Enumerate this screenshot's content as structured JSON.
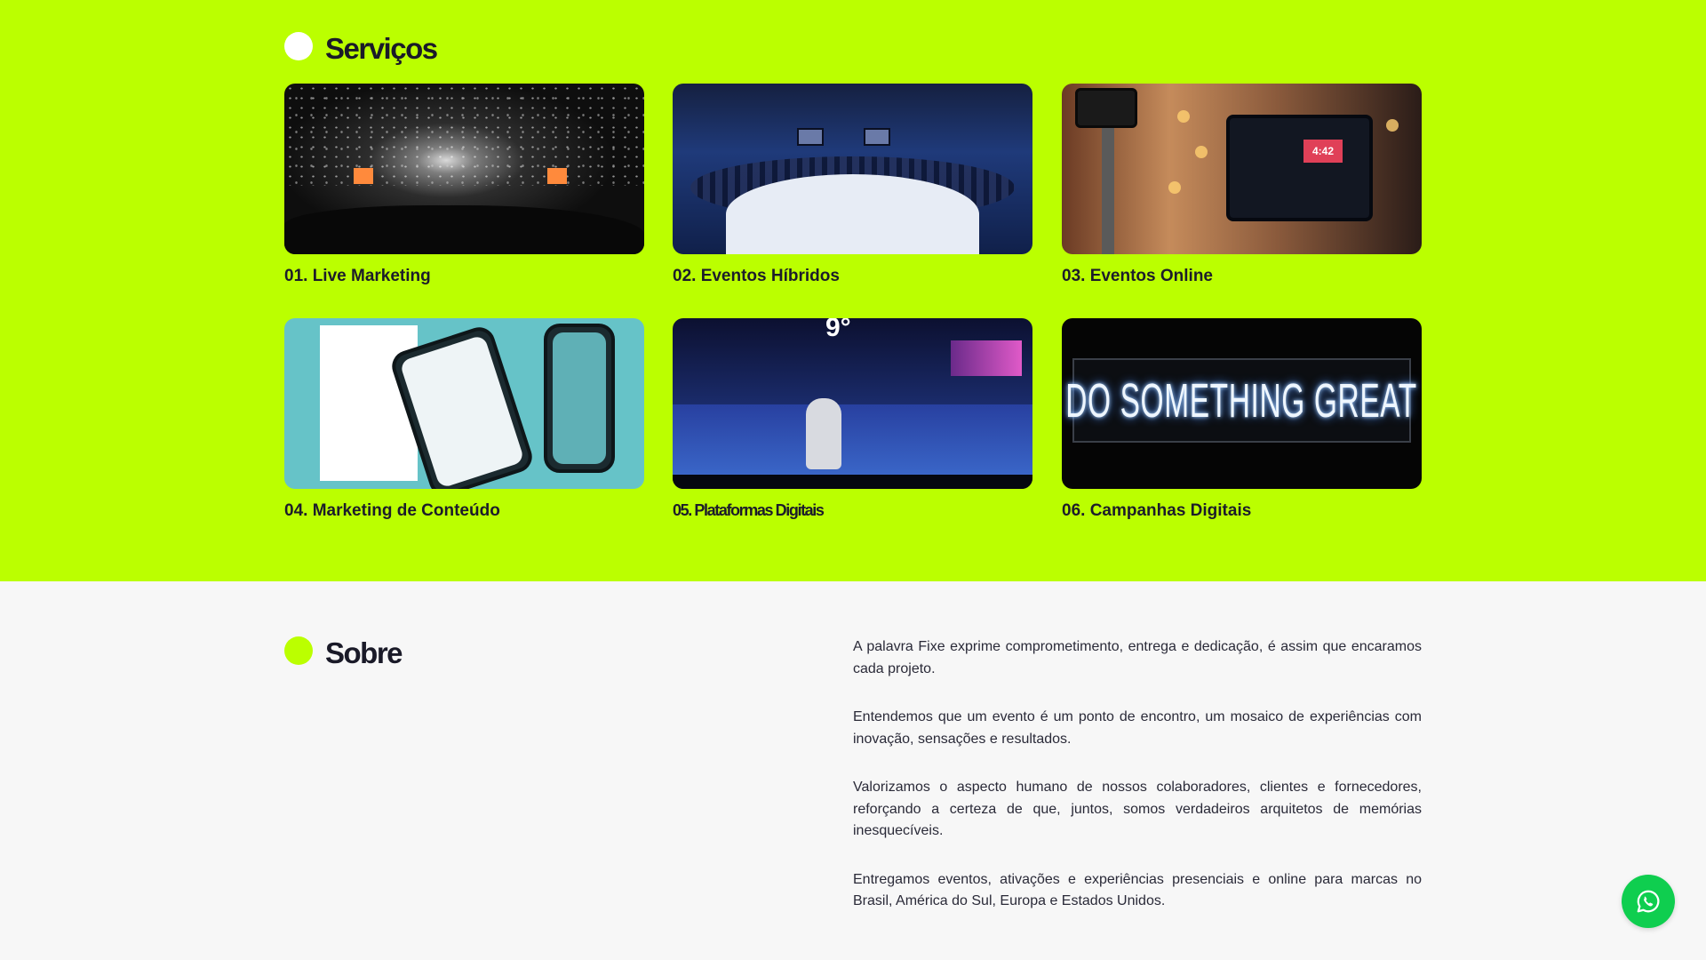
{
  "services": {
    "title": "Serviços",
    "cards": [
      {
        "label": "01. Live Marketing",
        "image": "concert-crowd-photo"
      },
      {
        "label": "02. Eventos Híbridos",
        "image": "panel-event-stage-photo"
      },
      {
        "label": "03. Eventos Online",
        "image": "streaming-setup-photo"
      },
      {
        "label": "04. Marketing de Conteúdo",
        "image": "social-media-phones-mockup"
      },
      {
        "label": "05. Plataformas Digitais",
        "image": "virtual-event-platform-render"
      },
      {
        "label": "06. Campanhas Digitais",
        "image": "neon-sign-photo"
      }
    ]
  },
  "thumb_text": {
    "event_number": "9°",
    "tablet_time": "4:42",
    "neon_sign": "DO SOMETHING GREAT"
  },
  "about": {
    "title": "Sobre",
    "paragraphs": [
      "A palavra Fixe exprime comprometimento, entrega e dedicação, é assim que encaramos cada projeto.",
      "Entendemos que um evento é um ponto de encontro, um mosaico de experiências com inovação, sensações e resultados.",
      "Valorizamos o aspecto humano de nossos colaboradores, clientes e fornecedores, reforçando a certeza de que, juntos, somos verdadeiros arquitetos de memórias inesquecíveis.",
      "Entregamos eventos, ativações e experiências presenciais e online para marcas no Brasil, América do Sul, Europa e Estados Unidos."
    ]
  },
  "whatsapp": {
    "icon": "whatsapp-icon"
  },
  "colors": {
    "accent": "#bbff00",
    "whatsapp": "#0fce4f",
    "about_bg": "#f7f7f7"
  }
}
